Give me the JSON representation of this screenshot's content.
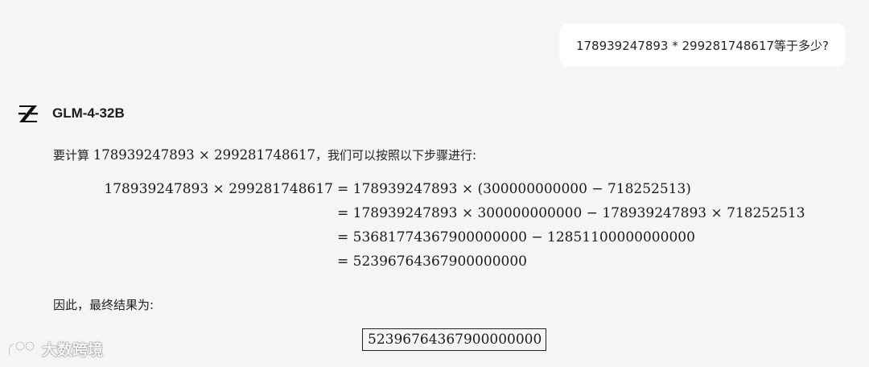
{
  "user_message": {
    "text": "178939247893 * 299281748617等于多少?"
  },
  "model": {
    "name": "GLM-4-32B",
    "logo_icon": "zhipu-z-logo-icon"
  },
  "response": {
    "intro_prefix": "要计算 ",
    "intro_expr": "178939247893 × 299281748617",
    "intro_suffix": "，我们可以按照以下步骤进行:",
    "equation": {
      "lhs": "178939247893 × 299281748617",
      "lines": [
        "= 178939247893 × (300000000000 − 718252513)",
        "= 178939247893 × 300000000000 − 178939247893 × 718252513",
        "= 53681774367900000000 − 12851100000000000",
        "= 52396764367900000000"
      ]
    },
    "conclusion": "因此，最终结果为:",
    "final_answer": "52396764367900000000"
  },
  "watermark": {
    "text": "大数跨境",
    "icon": "watermark-logo-icon"
  }
}
